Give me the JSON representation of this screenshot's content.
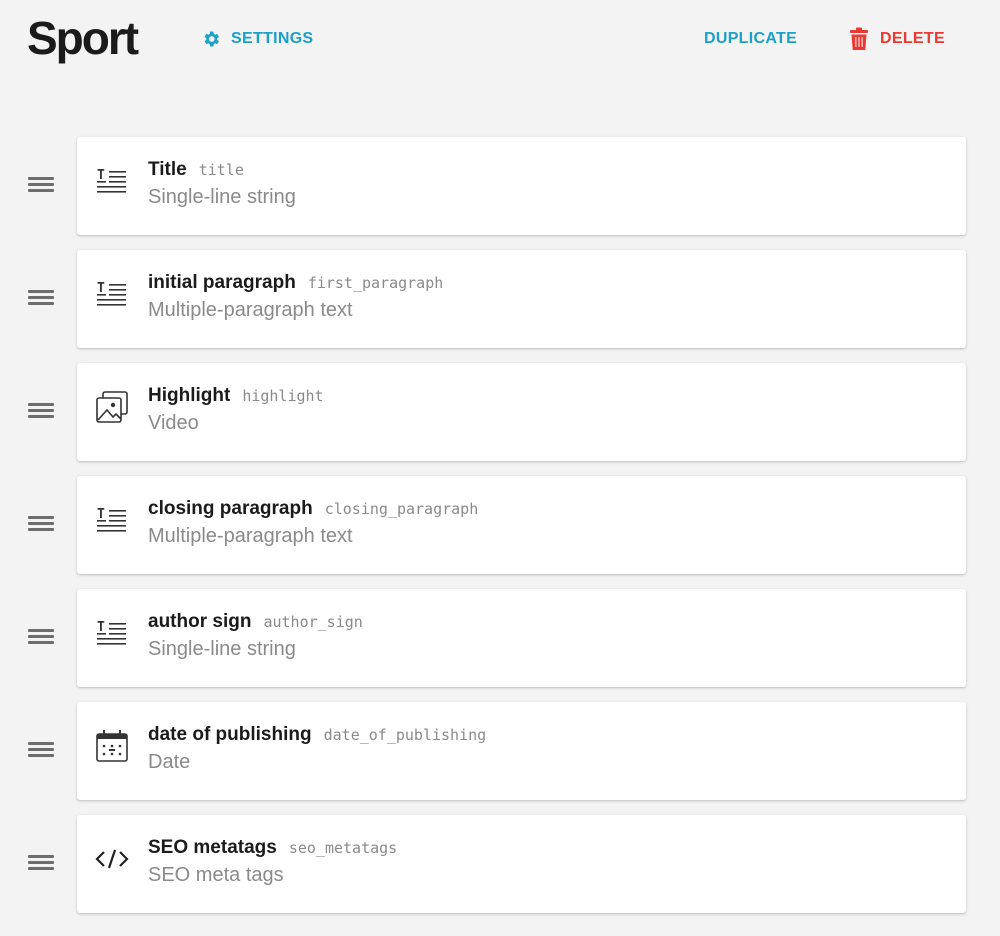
{
  "header": {
    "title": "Sport",
    "settings_label": "SETTINGS",
    "duplicate_label": "DUPLICATE",
    "delete_label": "DELETE"
  },
  "colors": {
    "accent": "#1aa1c8",
    "danger": "#e83a33"
  },
  "fields": [
    {
      "name": "Title",
      "api_key": "title",
      "type": "Single-line string",
      "icon": "text-field-icon"
    },
    {
      "name": "initial paragraph",
      "api_key": "first_paragraph",
      "type": "Multiple-paragraph text",
      "icon": "text-field-icon"
    },
    {
      "name": "Highlight",
      "api_key": "highlight",
      "type": "Video",
      "icon": "image-gallery-icon"
    },
    {
      "name": "closing paragraph",
      "api_key": "closing_paragraph",
      "type": "Multiple-paragraph text",
      "icon": "text-field-icon"
    },
    {
      "name": "author sign",
      "api_key": "author_sign",
      "type": "Single-line string",
      "icon": "text-field-icon"
    },
    {
      "name": "date of publishing",
      "api_key": "date_of_publishing",
      "type": "Date",
      "icon": "calendar-icon"
    },
    {
      "name": "SEO metatags",
      "api_key": "seo_metatags",
      "type": "SEO meta tags",
      "icon": "code-icon"
    }
  ]
}
